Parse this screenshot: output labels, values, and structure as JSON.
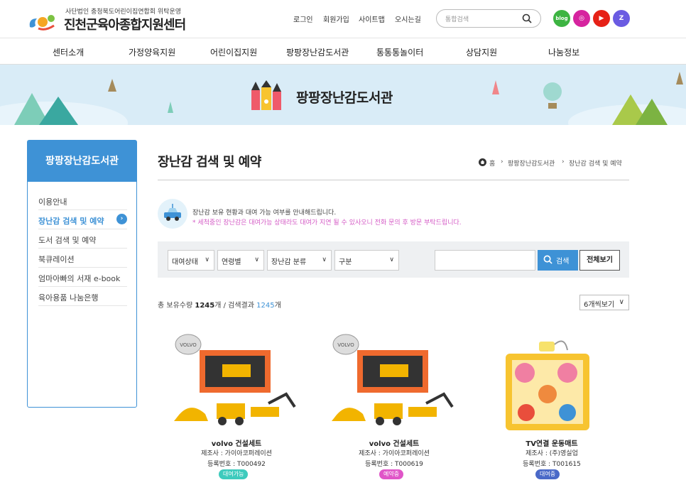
{
  "header": {
    "logo_sub": "사단법인 충청북도어린이집연합회 위탁운영",
    "logo_title": "진천군육아종합지원센터",
    "util_links": [
      "로그인",
      "회원가입",
      "사이트맵",
      "오시는길"
    ],
    "search_placeholder": "통합검색",
    "sns": [
      {
        "name": "blog",
        "label": "blog",
        "color": "#3db442"
      },
      {
        "name": "instagram",
        "label": "◎",
        "color": "#d6249f"
      },
      {
        "name": "youtube",
        "label": "▶",
        "color": "#e62117"
      },
      {
        "name": "z",
        "label": "Z",
        "color": "#6a5be2"
      }
    ]
  },
  "gnb": [
    "센터소개",
    "가정양육지원",
    "어린이집지원",
    "팡팡장난감도서관",
    "통통통놀이터",
    "상담지원",
    "나눔정보"
  ],
  "banner": {
    "title": "팡팡장난감도서관"
  },
  "sidebar": {
    "title": "팡팡장난감도서관",
    "items": [
      "이용안내",
      "장난감 검색 및 예약",
      "도서 검색 및 예약",
      "북큐레이션",
      "엄마아빠의 서재 e-book",
      "육아용품 나눔은행"
    ],
    "active_index": 1
  },
  "main": {
    "title": "장난감 검색 및 예약",
    "breadcrumb": [
      "홈",
      "팡팡장난감도서관",
      "장난감 검색 및 예약"
    ],
    "info": "장난감 보유 현황과 대여 가능 여부를 안내해드립니다.",
    "notice": "* 세척중인 장난감은 대여가능 상태라도 대여가 지연 될 수 있사오니 전화 문의 후 방문 부탁드립니다.",
    "filters": [
      "대여상태",
      "연령별",
      "장난감 분류",
      "구분"
    ],
    "search_button": "검색",
    "view_all_button": "전체보기",
    "count_prefix": "총 보유수량 ",
    "total": "1245",
    "count_mid": "개 / 검색결과 ",
    "results": "1245",
    "count_suffix": "개",
    "per_page": "6개씩보기"
  },
  "products": [
    {
      "name": "volvo 건설세트",
      "maker": "제조사 : 가이아코퍼레이션",
      "reg": "등록번호 : T000492",
      "status": "대여가능",
      "status_color": "#3ecbbd"
    },
    {
      "name": "volvo 건설세트",
      "maker": "제조사 : 가이아코퍼레이션",
      "reg": "등록번호 : T000619",
      "status": "예약중",
      "status_color": "#e055c8"
    },
    {
      "name": "TV연결 운동매트",
      "maker": "제조사 : (주)영실업",
      "reg": "등록번호 : T001615",
      "status": "대여중",
      "status_color": "#4a69c8"
    }
  ],
  "colors": {
    "accent": "#3e92d6",
    "banner_bg": "#d9ecf7"
  }
}
